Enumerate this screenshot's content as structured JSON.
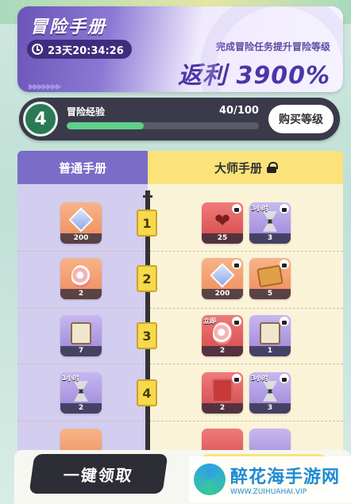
{
  "header": {
    "title": "冒险手册",
    "timer": "23天20:34:26",
    "subtitle": "完成冒险任务提升冒险等级",
    "rebate": "返利 3900%"
  },
  "xp": {
    "level": "4",
    "label": "冒险经验",
    "value": "40/100",
    "progress": 0.4,
    "buy_label": "购买等级"
  },
  "tabs": {
    "normal": "普通手册",
    "master": "大师手册"
  },
  "tiers": [
    {
      "num": "1",
      "normal": {
        "icon": "crystal-icon",
        "count": "200"
      },
      "master": [
        {
          "icon": "heart-badge-icon",
          "count": "25",
          "tag": ""
        },
        {
          "icon": "hourglass-icon",
          "count": "3",
          "tag": "3小时"
        }
      ]
    },
    {
      "num": "2",
      "normal": {
        "icon": "egg-icon",
        "count": "2"
      },
      "master": [
        {
          "icon": "crystal-icon",
          "count": "200",
          "tag": ""
        },
        {
          "icon": "biscuit-icon",
          "count": "5",
          "tag": ""
        }
      ]
    },
    {
      "num": "3",
      "normal": {
        "icon": "book-icon",
        "count": "7"
      },
      "master": [
        {
          "icon": "egg-icon",
          "count": "2",
          "tag": "立即"
        },
        {
          "icon": "book-icon",
          "count": "1",
          "tag": ""
        }
      ]
    },
    {
      "num": "4",
      "normal": {
        "icon": "hourglass-icon",
        "count": "2",
        "tag": "1小时"
      },
      "master": [
        {
          "icon": "red-book-icon",
          "count": "2",
          "tag": ""
        },
        {
          "icon": "hourglass-icon",
          "count": "3",
          "tag": "3小时"
        }
      ]
    }
  ],
  "claim_label": "一键领取",
  "watermark": {
    "name": "醉花海手游网",
    "url": "WWW.ZUIHUAHAI.VIP"
  }
}
